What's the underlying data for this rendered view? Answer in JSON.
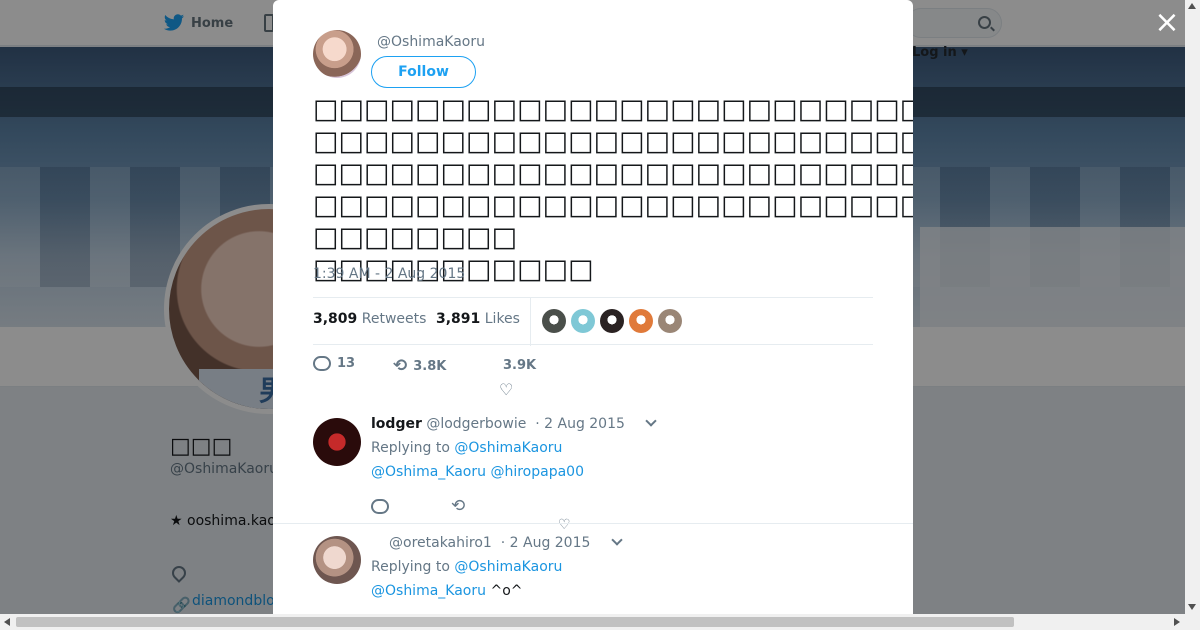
{
  "nav": {
    "home_label": "Home",
    "login_label": "Log in",
    "search_placeholder": ""
  },
  "background_profile": {
    "name": "□□□",
    "handle": "@OshimaKaoru",
    "bio": "★ ooshima.kao",
    "link": "diamondblo",
    "shirt_char": "男"
  },
  "tweet": {
    "author_handle": "@OshimaKaoru",
    "follow_label": "Follow",
    "text": "□□□□□□□□□□□□□□□□□□□□□□□□\n□□□□□□□□□□□□□□□□□□□□□□□□□□□□□□□□□□\n□□□□□□□□□□□□□□□□□□□□□□□□□□□□□□□□□□□□□…□□□□□□□□□□□□□□□□□□□□□□□□□□□□\n□□□□□□□□\n□□□□□□□□□□□",
    "timestamp": "1:39 AM - 2 Aug 2015",
    "retweets_count": "3,809",
    "retweets_label": "Retweets",
    "likes_count": "3,891",
    "likes_label": "Likes",
    "liker_colors": [
      "#4a4f4a",
      "#7fc8d6",
      "#2a2222",
      "#e07a3a",
      "#9a8676"
    ],
    "reply_count": "13",
    "retweet_short": "3.8K",
    "like_short": "3.9K"
  },
  "replies": [
    {
      "name": "lodger",
      "handle": "@lodgerbowie",
      "date": "· 2 Aug 2015",
      "replying_prefix": "Replying to",
      "replying_to": "@OshimaKaoru",
      "mention_1": "@Oshima_Kaoru",
      "mention_2": "@hiropapa00",
      "body_text": ""
    },
    {
      "name": "",
      "handle": "@oretakahiro1",
      "date": "· 2 Aug 2015",
      "replying_prefix": "Replying to",
      "replying_to": "@OshimaKaoru",
      "mention_1": "@Oshima_Kaoru",
      "body_text": "^o^"
    }
  ],
  "close_label": "×"
}
